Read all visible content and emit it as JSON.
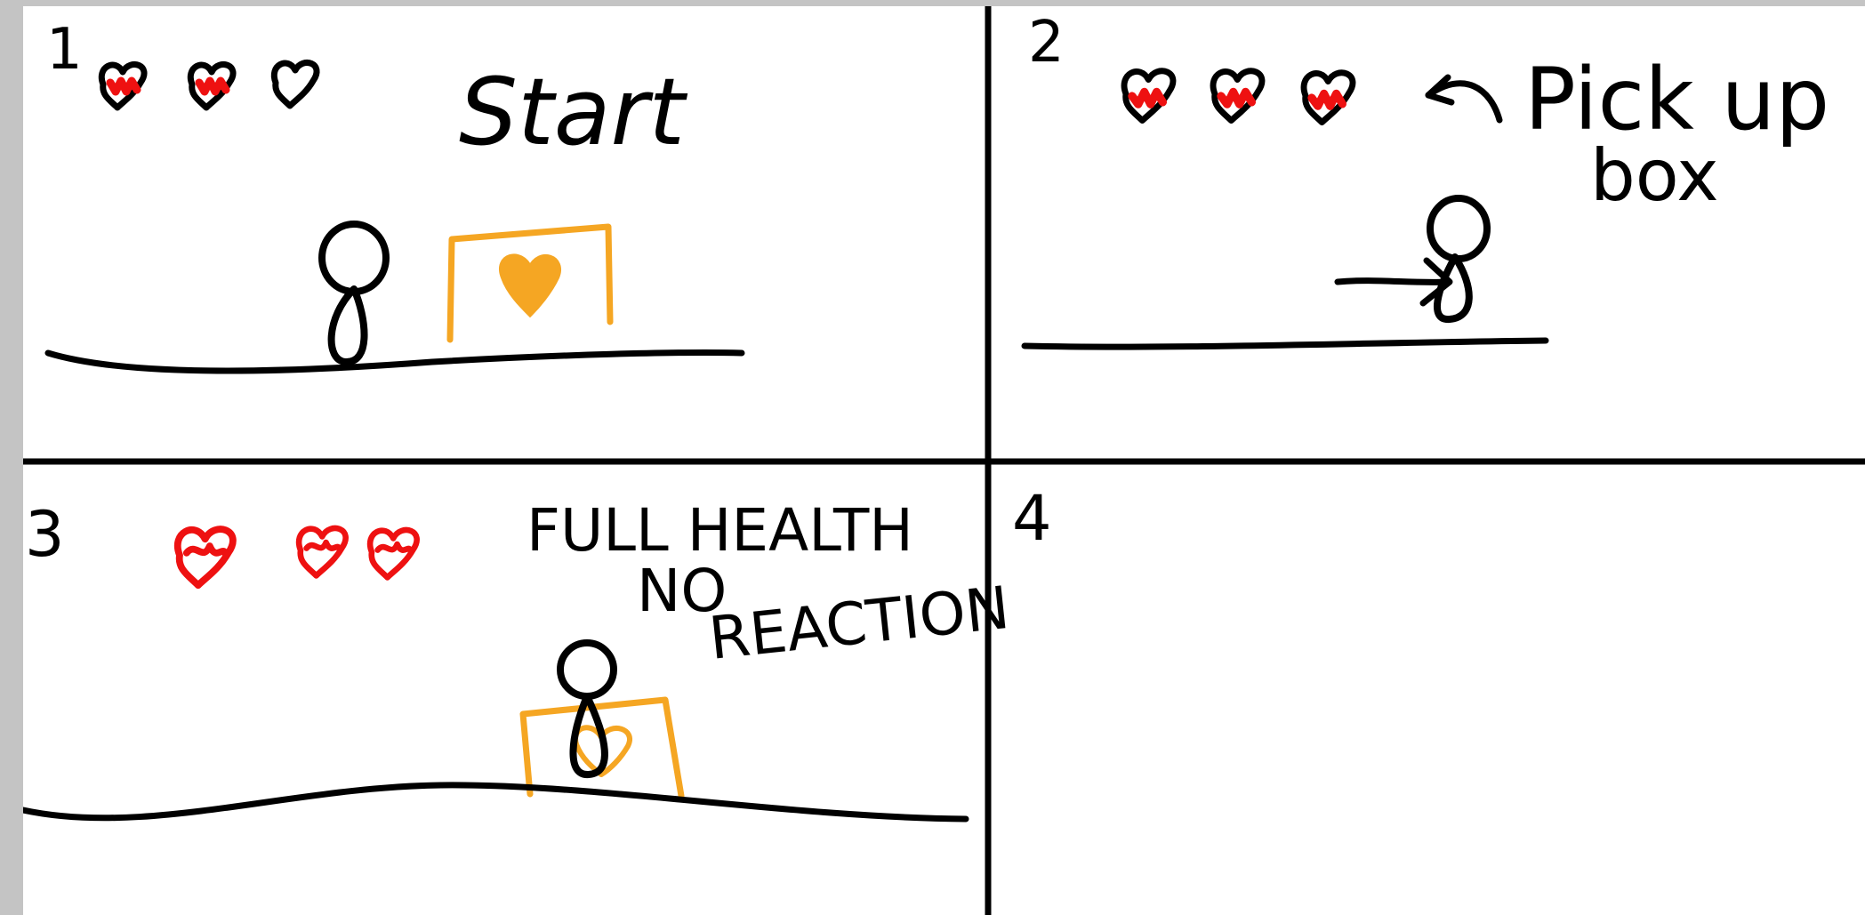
{
  "colors": {
    "ink": "#000000",
    "health_red": "#ee1111",
    "pickup_orange": "#f5a623",
    "paper": "#ffffff",
    "frame_gray": "#c4c4c4"
  },
  "panels": [
    {
      "number": "1",
      "caption_lines": [
        "Start"
      ],
      "hearts_filled": 2,
      "hearts_total": 3,
      "shows_pickup_box": true,
      "player_state": "standing"
    },
    {
      "number": "2",
      "caption_lines": [
        "Pick up",
        "box"
      ],
      "hearts_filled": 3,
      "hearts_total": 3,
      "shows_pickup_box": false,
      "player_state": "moving right"
    },
    {
      "number": "3",
      "caption_lines": [
        "FULL HEALTH",
        "NO",
        "REACTION"
      ],
      "hearts_filled": 3,
      "hearts_total": 3,
      "shows_pickup_box": true,
      "player_state": "standing on box"
    },
    {
      "number": "4",
      "caption_lines": [],
      "hearts_filled": 0,
      "hearts_total": 0,
      "shows_pickup_box": false,
      "player_state": "empty"
    }
  ]
}
